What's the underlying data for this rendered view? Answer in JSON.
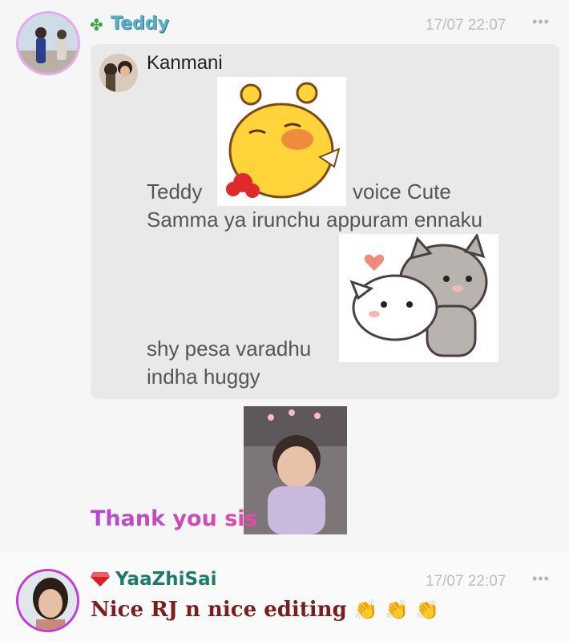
{
  "post": {
    "username": "Teddy",
    "timestamp": "17/07 22:07",
    "more": "•••",
    "quote": {
      "author": "Kanmani",
      "line1a": "Teddy",
      "line1b": "voice Cute",
      "line2": "Samma ya irunchu appuram ennaku",
      "line3": "shy pesa varadhu",
      "line4": "indha huggy"
    },
    "message": "Thank you sis"
  },
  "comment": {
    "username": "YaaZhiSai",
    "timestamp": "17/07 22:07",
    "more": "•••",
    "text": "Nice RJ n nice editing",
    "emoji": "👏 👏 👏"
  },
  "icons": {
    "post_badge": "clover-icon",
    "comment_badge": "gem-icon"
  },
  "colors": {
    "teddy_name": "#5ab0c7",
    "yaazhisai_name": "#1e7a6d",
    "message_gradient_start": "#b04bd1",
    "message_gradient_end": "#e44aa3",
    "comment_text": "#7a1d1d"
  }
}
